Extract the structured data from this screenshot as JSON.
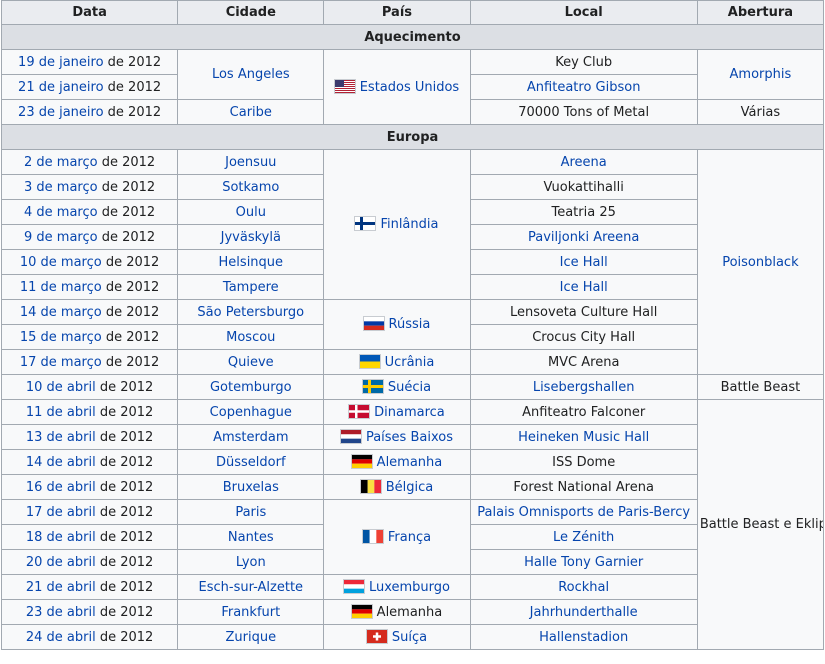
{
  "headers": [
    "Data",
    "Cidade",
    "País",
    "Local",
    "Abertura"
  ],
  "sections": {
    "warmup": "Aquecimento",
    "europe": "Europa"
  },
  "flags": {
    "usa": "usa-flag-icon",
    "finland": "finland-flag-icon",
    "russia": "russia-flag-icon",
    "ukraine": "ukraine-flag-icon",
    "sweden": "sweden-flag-icon",
    "denmark": "denmark-flag-icon",
    "netherlands": "netherlands-flag-icon",
    "germany": "germany-flag-icon",
    "belgium": "belgium-flag-icon",
    "france": "france-flag-icon",
    "luxembourg": "luxembourg-flag-icon",
    "switzerland": "switzerland-flag-icon"
  },
  "colors": {
    "link": "#0645ad",
    "header_bg": "#eaecf0",
    "section_bg": "#dcdfe4",
    "border": "#a2a9b1"
  },
  "rows": [
    {
      "date": "19 de janeiro",
      "year": " de 2012",
      "city": "Los Angeles",
      "country": "Estados Unidos",
      "venue": "Key Club",
      "opening": "Amorphis"
    },
    {
      "date": "21 de janeiro",
      "year": " de 2012",
      "venue": "Anfiteatro Gibson"
    },
    {
      "date": "23 de janeiro",
      "year": " de 2012",
      "city": "Caribe",
      "venue": "70000 Tons of Metal",
      "opening": "Várias"
    },
    {
      "date": "2 de março",
      "year": " de 2012",
      "city": "Joensuu",
      "country": "Finlândia",
      "venue": "Areena",
      "opening": "Poisonblack"
    },
    {
      "date": "3 de março",
      "year": " de 2012",
      "city": "Sotkamo",
      "venue": "Vuokattihalli"
    },
    {
      "date": "4 de março",
      "year": " de 2012",
      "city": "Oulu",
      "venue": "Teatria 25"
    },
    {
      "date": "9 de março",
      "year": " de 2012",
      "city": "Jyväskylä",
      "venue": "Paviljonki Areena"
    },
    {
      "date": "10 de março",
      "year": " de 2012",
      "city": "Helsinque",
      "venue": "Ice Hall"
    },
    {
      "date": "11 de março",
      "year": " de 2012",
      "city": "Tampere",
      "venue": "Ice Hall"
    },
    {
      "date": "14 de março",
      "year": " de 2012",
      "city": "São Petersburgo",
      "country": "Rússia",
      "venue": "Lensoveta Culture Hall"
    },
    {
      "date": "15 de março",
      "year": " de 2012",
      "city": "Moscou",
      "venue": "Crocus City Hall"
    },
    {
      "date": "17 de março",
      "year": " de 2012",
      "city": "Quieve",
      "country": "Ucrânia",
      "venue": "MVC Arena"
    },
    {
      "date": "10 de abril",
      "year": " de 2012",
      "city": "Gotemburgo",
      "country": "Suécia",
      "venue": "Lisebergshallen",
      "opening": "Battle Beast"
    },
    {
      "date": "11 de abril",
      "year": " de 2012",
      "city": "Copenhague",
      "country": "Dinamarca",
      "venue": "Anfiteatro Falconer",
      "opening": "Battle Beast e Eklipse"
    },
    {
      "date": "13 de abril",
      "year": " de 2012",
      "city": "Amsterdam",
      "country": "Países Baixos",
      "venue": "Heineken Music Hall"
    },
    {
      "date": "14 de abril",
      "year": " de 2012",
      "city": "Düsseldorf",
      "country": "Alemanha",
      "venue": "ISS Dome"
    },
    {
      "date": "16 de abril",
      "year": " de 2012",
      "city": "Bruxelas",
      "country": "Bélgica",
      "venue": "Forest National Arena"
    },
    {
      "date": "17 de abril",
      "year": " de 2012",
      "city": "Paris",
      "country": "França",
      "venue": "Palais Omnisports de Paris-Bercy"
    },
    {
      "date": "18 de abril",
      "year": " de 2012",
      "city": "Nantes",
      "venue": "Le Zénith"
    },
    {
      "date": "20 de abril",
      "year": " de 2012",
      "city": "Lyon",
      "venue": "Halle Tony Garnier"
    },
    {
      "date": "21 de abril",
      "year": " de 2012",
      "city": "Esch-sur-Alzette",
      "country": "Luxemburgo",
      "venue": "Rockhal"
    },
    {
      "date": "23 de abril",
      "year": " de 2012",
      "city": "Frankfurt",
      "country": "Alemanha",
      "venue": "Jahrhunderthalle"
    },
    {
      "date": "24 de abril",
      "year": " de 2012",
      "city": "Zurique",
      "country": "Suíça",
      "venue": "Hallenstadion"
    }
  ]
}
